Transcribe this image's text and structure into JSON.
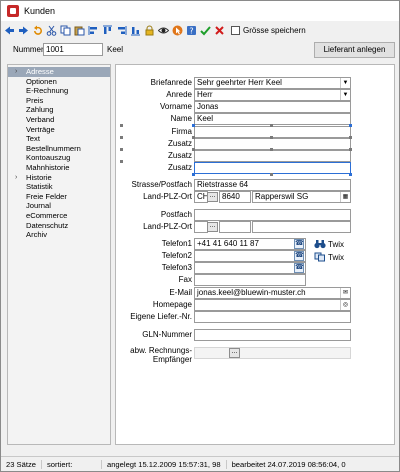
{
  "window": {
    "title": "Kunden"
  },
  "toolbar": {
    "icons": [
      "arrow-left-icon",
      "arrow-right-icon",
      "undo-icon",
      "cut-icon",
      "copy-icon",
      "paste-icon",
      "align-left-icon",
      "align-top-icon",
      "align-right-icon",
      "align-bottom-icon",
      "lock-icon",
      "eye-icon",
      "pointer-icon",
      "help-icon",
      "check-icon",
      "close-icon"
    ],
    "checkbox_label": "Grösse speichern"
  },
  "number_row": {
    "label": "Nummer",
    "value": "1001",
    "name": "Keel",
    "button": "Lieferant anlegen"
  },
  "nav": {
    "items": [
      {
        "label": "Adresse",
        "selected": true,
        "arrow": true
      },
      {
        "label": "Optionen"
      },
      {
        "label": "E-Rechnung"
      },
      {
        "label": "Preis"
      },
      {
        "label": "Zahlung"
      },
      {
        "label": "Verband"
      },
      {
        "label": "Verträge"
      },
      {
        "label": "Text"
      },
      {
        "label": "Bestellnummern"
      },
      {
        "label": "Kontoauszug"
      },
      {
        "label": "Mahnhistorie"
      },
      {
        "label": "Historie",
        "arrow": true
      },
      {
        "label": "Statistik"
      },
      {
        "label": "Freie Felder"
      },
      {
        "label": "Journal"
      },
      {
        "label": "eCommerce"
      },
      {
        "label": "Datenschutz"
      },
      {
        "label": "Archiv"
      }
    ]
  },
  "form": {
    "briefanrede_label": "Briefanrede",
    "briefanrede_value": "Sehr geehrter Herr Keel",
    "anrede_label": "Anrede",
    "anrede_value": "Herr",
    "vorname_label": "Vorname",
    "vorname_value": "Jonas",
    "name_label": "Name",
    "name_value": "Keel",
    "firma_label": "Firma",
    "zusatz1_label": "Zusatz",
    "zusatz2_label": "Zusatz",
    "zusatz3_label": "Zusatz",
    "strasse_label": "Strasse/Postfach",
    "strasse_value": "Rietstrasse 64",
    "land_plz_ort_label": "Land-PLZ-Ort",
    "land_value": "CH",
    "plz_value": "8640",
    "ort_value": "Rapperswil SG",
    "postfach_label": "Postfach",
    "land_plz_ort2_label": "Land-PLZ-Ort",
    "telefon1_label": "Telefon1",
    "telefon1_value": "+41 41 640 11 87",
    "telefon2_label": "Telefon2",
    "telefon3_label": "Telefon3",
    "fax_label": "Fax",
    "twix_label": "Twix",
    "email_label": "E-Mail",
    "email_value": "jonas.keel@bluewin-muster.ch",
    "homepage_label": "Homepage",
    "eigene_lief_label": "Eigene Liefer.-Nr.",
    "gln_label": "GLN-Nummer",
    "abw_label_1": "abw. Rechnungs-",
    "abw_label_2": "Empfänger",
    "dots": "..."
  },
  "status": {
    "count": "23 Sätze",
    "sorted": "sortiert:",
    "created": "angelegt 15.12.2009 15:57:31, 98",
    "edited": "bearbeitet 24.07.2019 08:56:04,  0"
  }
}
